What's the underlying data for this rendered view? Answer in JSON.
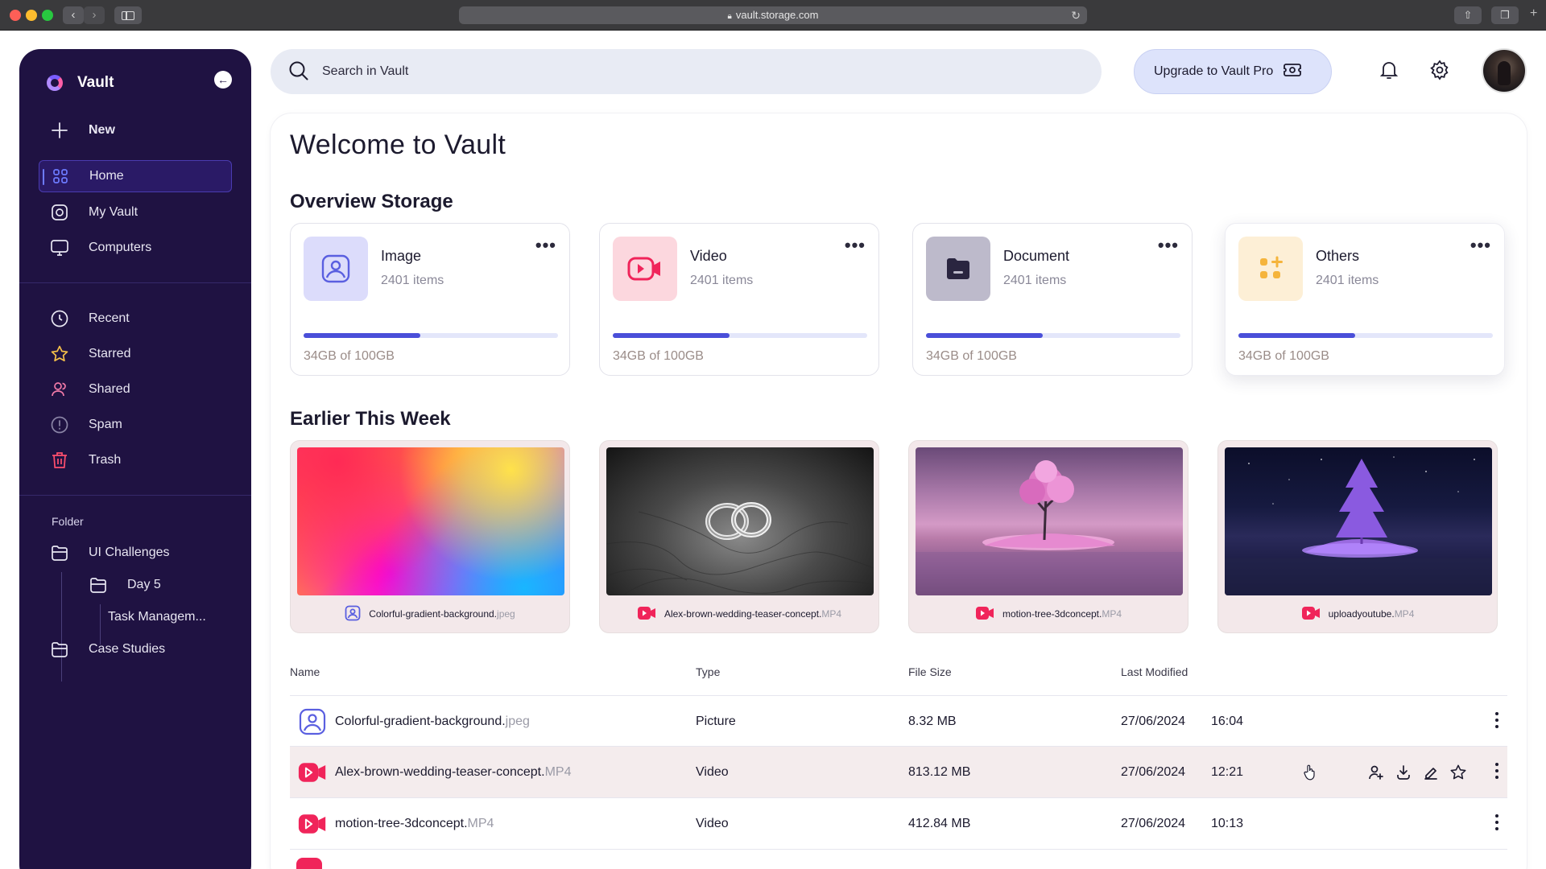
{
  "browser": {
    "url": "vault.storage.com"
  },
  "sidebar": {
    "brand": "Vault",
    "new_label": "New",
    "nav": [
      {
        "label": "Home",
        "icon": "grid-icon",
        "active": true
      },
      {
        "label": "My Vault",
        "icon": "vault-icon"
      },
      {
        "label": "Computers",
        "icon": "computer-icon"
      }
    ],
    "library": [
      {
        "label": "Recent",
        "icon": "clock-icon"
      },
      {
        "label": "Starred",
        "icon": "star-icon"
      },
      {
        "label": "Shared",
        "icon": "users-icon"
      },
      {
        "label": "Spam",
        "icon": "alert-icon"
      },
      {
        "label": "Trash",
        "icon": "trash-icon"
      }
    ],
    "folder_title": "Folder",
    "folders": [
      {
        "label": "UI Challenges",
        "level": 0
      },
      {
        "label": "Day 5",
        "level": 1
      },
      {
        "label": "Task Managem...",
        "level": 2
      },
      {
        "label": "Case Studies",
        "level": 0
      }
    ]
  },
  "topbar": {
    "search_placeholder": "Search in Vault",
    "upgrade_label": "Upgrade to Vault Pro"
  },
  "main": {
    "welcome": "Welcome to Vault",
    "overview_title": "Overview Storage",
    "storage": [
      {
        "name": "Image",
        "count": "2401 items",
        "usage": "34GB of 100GB",
        "used_fraction": 0.46,
        "color": "#dcdcfb",
        "icon_color": "#5a5fe0"
      },
      {
        "name": "Video",
        "count": "2401 items",
        "usage": "34GB of 100GB",
        "used_fraction": 0.46,
        "color": "#fcd7de",
        "icon_color": "#f0245a"
      },
      {
        "name": "Document",
        "count": "2401 items",
        "usage": "34GB of 100GB",
        "used_fraction": 0.46,
        "color": "#bdbacb",
        "icon_color": "#2a2540"
      },
      {
        "name": "Others",
        "count": "2401 items",
        "usage": "34GB of 100GB",
        "used_fraction": 0.46,
        "color": "#fdefd6",
        "icon_color": "#f5b43c"
      }
    ],
    "earlier_title": "Earlier This Week",
    "media": [
      {
        "name": "Colorful-gradient-background.",
        "ext": "jpeg",
        "kind": "image"
      },
      {
        "name": "Alex-brown-wedding-teaser-concept.",
        "ext": "MP4",
        "kind": "video"
      },
      {
        "name": "motion-tree-3dconcept.",
        "ext": "MP4",
        "kind": "video"
      },
      {
        "name": "uploadyoutube.",
        "ext": "MP4",
        "kind": "video"
      }
    ],
    "table": {
      "headers": {
        "name": "Name",
        "type": "Type",
        "size": "File Size",
        "modified": "Last Modified"
      },
      "rows": [
        {
          "name": "Colorful-gradient-background.",
          "ext": "jpeg",
          "type": "Picture",
          "size": "8.32 MB",
          "date": "27/06/2024",
          "time": "16:04",
          "kind": "image"
        },
        {
          "name": "Alex-brown-wedding-teaser-concept.",
          "ext": "MP4",
          "type": "Video",
          "size": "813.12 MB",
          "date": "27/06/2024",
          "time": "12:21",
          "kind": "video"
        },
        {
          "name": "motion-tree-3dconcept.",
          "ext": "MP4",
          "type": "Video",
          "size": "412.84 MB",
          "date": "27/06/2024",
          "time": "10:13",
          "kind": "video"
        }
      ]
    }
  }
}
